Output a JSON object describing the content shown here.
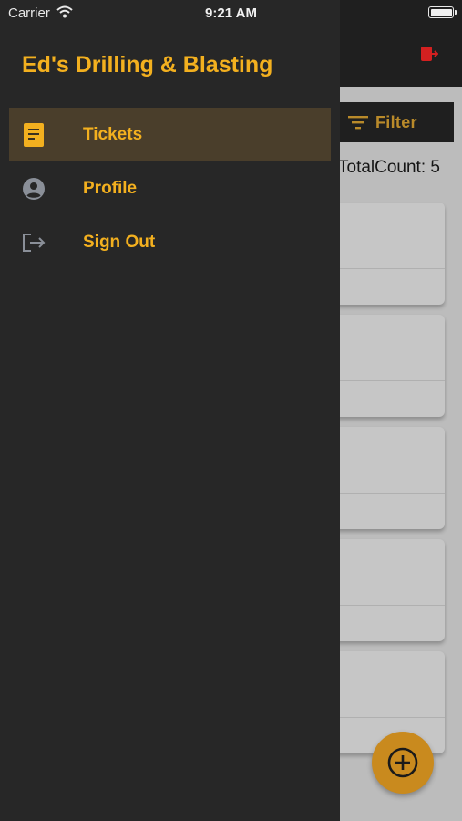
{
  "status_bar": {
    "carrier": "Carrier",
    "time": "9:21 AM"
  },
  "drawer": {
    "title": "Ed's Drilling & Blasting",
    "items": [
      {
        "label": "Tickets",
        "icon": "document-icon",
        "active": true
      },
      {
        "label": "Profile",
        "icon": "user-circle-icon",
        "active": false
      },
      {
        "label": "Sign Out",
        "icon": "sign-out-icon",
        "active": false
      }
    ]
  },
  "background_screen": {
    "filter_label": "Filter",
    "total_count": "TotalCount: 5",
    "exit_icon": "exit-icon",
    "fab_icon": "add-circle-icon"
  },
  "colors": {
    "accent": "#f3b01f",
    "drawer_bg": "#272727",
    "active_item_bg": "#4a3e2b",
    "fab": "#c98a1e",
    "exit_icon": "#d42020"
  }
}
